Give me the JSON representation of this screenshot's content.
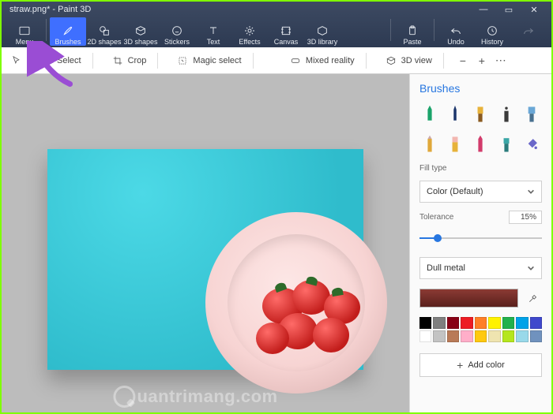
{
  "window": {
    "title": "straw.png* - Paint 3D",
    "buttons": {
      "min": "—",
      "max": "▭",
      "close": "✕"
    }
  },
  "ribbon": {
    "menu": "Menu",
    "items": [
      {
        "id": "brushes",
        "label": "Brushes",
        "selected": true
      },
      {
        "id": "2dshapes",
        "label": "2D shapes",
        "selected": false
      },
      {
        "id": "3dshapes",
        "label": "3D shapes",
        "selected": false
      },
      {
        "id": "stickers",
        "label": "Stickers",
        "selected": false
      },
      {
        "id": "text",
        "label": "Text",
        "selected": false
      },
      {
        "id": "effects",
        "label": "Effects",
        "selected": false
      },
      {
        "id": "canvas",
        "label": "Canvas",
        "selected": false
      },
      {
        "id": "3dlibrary",
        "label": "3D library",
        "selected": false
      }
    ],
    "right": [
      {
        "id": "paste",
        "label": "Paste"
      },
      {
        "id": "undo",
        "label": "Undo"
      },
      {
        "id": "history",
        "label": "History"
      }
    ]
  },
  "toolbar": {
    "select": "Select",
    "crop": "Crop",
    "magic": "Magic select",
    "mixed": "Mixed reality",
    "view3d": "3D view",
    "zoom_out": "−",
    "zoom_in": "+",
    "overflow": "⋯"
  },
  "panel": {
    "title": "Brushes",
    "brushes": [
      {
        "id": "marker",
        "color": "#1aa36a"
      },
      {
        "id": "calligraphy",
        "color": "#1b356b"
      },
      {
        "id": "oil",
        "color": "#e7b23a"
      },
      {
        "id": "spray",
        "color": "#3a3a3a"
      },
      {
        "id": "watercolor",
        "color": "#6aa7d6"
      },
      {
        "id": "pencil",
        "color": "#e0a83a"
      },
      {
        "id": "eraser",
        "color": "#e7b23a"
      },
      {
        "id": "crayon",
        "color": "#d23b6b"
      },
      {
        "id": "pixel",
        "color": "#3aa6a6"
      },
      {
        "id": "fill",
        "color": "#6a67c9"
      }
    ],
    "fill_label": "Fill type",
    "fill_value": "Color (Default)",
    "tolerance_label": "Tolerance",
    "tolerance_value": "15%",
    "material_value": "Dull metal",
    "addcolor": "Add color",
    "palette": [
      "#000000",
      "#7f7f7f",
      "#880015",
      "#ed1c24",
      "#ff7f27",
      "#fff200",
      "#22b14c",
      "#00a2e8",
      "#3f48cc",
      "#ffffff",
      "#c3c3c3",
      "#b97a57",
      "#ffaec9",
      "#ffc90e",
      "#efe4b0",
      "#b5e61d",
      "#99d9ea",
      "#7092be"
    ]
  },
  "watermark": "uantrimang.com"
}
